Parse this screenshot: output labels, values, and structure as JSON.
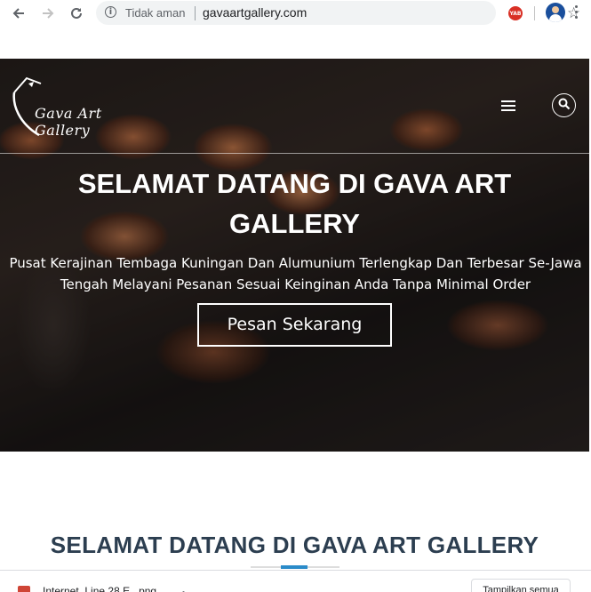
{
  "browser": {
    "security_label": "Tidak aman",
    "url": "gavaartgallery.com",
    "extension_badge": "YAB"
  },
  "site": {
    "logo_text": "Gava Art Gallery"
  },
  "hero": {
    "title": "SELAMAT DATANG DI GAVA ART GALLERY",
    "subtitle": "Pusat Kerajinan Tembaga Kuningan Dan Alumunium Terlengkap Dan Terbesar Se-Jawa Tengah Melayani Pesanan Sesuai Keinginan Anda Tanpa Minimal Order",
    "cta_label": "Pesan Sekarang"
  },
  "section": {
    "title": "SELAMAT DATANG DI GAVA ART GALLERY"
  },
  "downloads": {
    "file_name": "Internet_Line 28 E...png",
    "show_all_label": "Tampilkan semua"
  },
  "colors": {
    "accent": "#2a8bc9",
    "heading": "#2c3e50"
  }
}
